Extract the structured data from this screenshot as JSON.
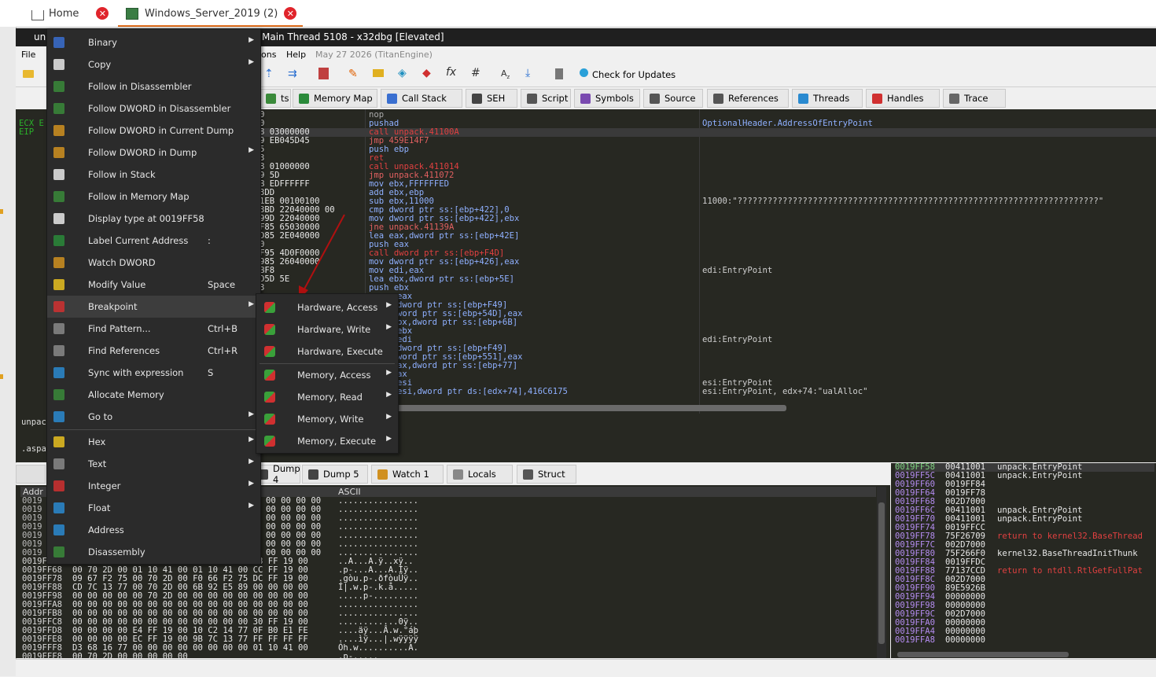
{
  "browser_tabs": [
    {
      "label": "Home",
      "close": "✕"
    },
    {
      "label": "Windows_Server_2019 (2)",
      "close": "✕"
    }
  ],
  "window": {
    "title_prefix": "un",
    "title": "Main Thread 5108 - x32dbg [Elevated]"
  },
  "menubar": {
    "file": "File",
    "options_partial": "ons",
    "help": "Help",
    "date": "May 27 2026 (TitanEngine)"
  },
  "toolbar": {
    "check_updates": "Check for Updates"
  },
  "view_tabs": [
    {
      "label": "ts",
      "icon": "log-icon"
    },
    {
      "label": "Memory Map",
      "icon": "memory-map-icon"
    },
    {
      "label": "Call Stack",
      "icon": "call-stack-icon"
    },
    {
      "label": "SEH",
      "icon": "seh-icon"
    },
    {
      "label": "Script",
      "icon": "script-icon"
    },
    {
      "label": "Symbols",
      "icon": "symbols-icon"
    },
    {
      "label": "Source",
      "icon": "source-icon"
    },
    {
      "label": "References",
      "icon": "references-icon"
    },
    {
      "label": "Threads",
      "icon": "threads-icon"
    },
    {
      "label": "Handles",
      "icon": "handles-icon"
    },
    {
      "label": "Trace",
      "icon": "trace-icon"
    }
  ],
  "registers_panel": {
    "line1": "ECX E",
    "line2": "EIP"
  },
  "disassembly": {
    "rows": [
      {
        "bytes": "0",
        "instr": "nop",
        "comment": ""
      },
      {
        "bytes": "0",
        "instr": "pushad",
        "comment": "OptionalHeader.AddressOfEntryPoint"
      },
      {
        "bytes": "8 03000000",
        "instr": "call unpack.41100A",
        "comment": ""
      },
      {
        "bytes": "9 EB045D45",
        "instr": "jmp 459E14F7",
        "comment": ""
      },
      {
        "bytes": "5",
        "instr": "push ebp",
        "comment": ""
      },
      {
        "bytes": "3",
        "instr": "ret",
        "comment": ""
      },
      {
        "bytes": "8 01000000",
        "instr": "call unpack.411014",
        "comment": ""
      },
      {
        "bytes": "9 5D",
        "instr": "jmp unpack.411072",
        "comment": ""
      },
      {
        "bytes": "B EDFFFFFF",
        "instr": "mov ebx,FFFFFFED",
        "comment": ""
      },
      {
        "bytes": "3DD",
        "instr": "add ebx,ebp",
        "comment": ""
      },
      {
        "bytes": "1EB 00100100",
        "instr": "sub ebx,11000",
        "comment": "11000:\"????????????????????????????????????????????????????????????????????????\""
      },
      {
        "bytes": "3BD 22040000 00",
        "instr": "cmp dword ptr ss:[ebp+422],0",
        "comment": ""
      },
      {
        "bytes": "99D 22040000",
        "instr": "mov dword ptr ss:[ebp+422],ebx",
        "comment": ""
      },
      {
        "bytes": "F85 65030000",
        "instr": "jne unpack.41139A",
        "comment": ""
      },
      {
        "bytes": "D85 2E040000",
        "instr": "lea eax,dword ptr ss:[ebp+42E]",
        "comment": ""
      },
      {
        "bytes": "0",
        "instr": "push eax",
        "comment": ""
      },
      {
        "bytes": "F95 4D0F0000",
        "instr": "call dword ptr ss:[ebp+F4D]",
        "comment": ""
      },
      {
        "bytes": "985 26040000",
        "instr": "mov dword ptr ss:[ebp+426],eax",
        "comment": ""
      },
      {
        "bytes": "BF8",
        "instr": "mov edi,eax",
        "comment": "edi:EntryPoint"
      },
      {
        "bytes": "D5D 5E",
        "instr": "lea ebx,dword ptr ss:[ebp+5E]",
        "comment": ""
      },
      {
        "bytes": "3",
        "instr": "push ebx",
        "comment": ""
      },
      {
        "bytes": "",
        "instr": "eax",
        "comment": ""
      },
      {
        "bytes": "",
        "instr": "dword ptr ss:[ebp+F49]",
        "comment": ""
      },
      {
        "bytes": "",
        "instr": "word ptr ss:[ebp+54D],eax",
        "comment": ""
      },
      {
        "bytes": "",
        "instr": "bx,dword ptr ss:[ebp+6B]",
        "comment": ""
      },
      {
        "bytes": "",
        "instr": "ebx",
        "comment": ""
      },
      {
        "bytes": "",
        "instr": "edi",
        "comment": "edi:EntryPoint"
      },
      {
        "bytes": "",
        "instr": "dword ptr ss:[ebp+F49]",
        "comment": ""
      },
      {
        "bytes": "",
        "instr": "word ptr ss:[ebp+551],eax",
        "comment": ""
      },
      {
        "bytes": "",
        "instr": "ax,dword ptr ss:[ebp+77]",
        "comment": ""
      },
      {
        "bytes": "",
        "instr": "ax",
        "comment": ""
      },
      {
        "bytes": "",
        "instr": "esi",
        "comment": "esi:EntryPoint"
      },
      {
        "bytes": "",
        "instr": "esi,dword ptr ds:[edx+74],416C6175",
        "comment": "esi:EntryPoint, edx+74:\"ualAlloc\""
      }
    ]
  },
  "middle_panel": {
    "line1": "unpac",
    "line2": ".aspa"
  },
  "dump_tabs": [
    {
      "label": "Dump 4",
      "icon": "dump-icon"
    },
    {
      "label": "Dump 5",
      "icon": "dump-icon"
    },
    {
      "label": "Watch 1",
      "icon": "watch-icon"
    },
    {
      "label": "Locals",
      "icon": "locals-icon"
    },
    {
      "label": "Struct",
      "icon": "struct-icon"
    }
  ],
  "dump": {
    "col_addr": "Addr",
    "col_ascii": "ASCII",
    "rows": [
      {
        "addr": "0019",
        "hex": "00 00 00 00",
        "ascii": "................"
      },
      {
        "addr": "0019",
        "hex": "00 00 00 00",
        "ascii": "................"
      },
      {
        "addr": "0019",
        "hex": "00 00 00 00",
        "ascii": "................"
      },
      {
        "addr": "0019",
        "hex": "00 00 00 00",
        "ascii": "................"
      },
      {
        "addr": "0019",
        "hex": "00 00 00 00",
        "ascii": "................"
      },
      {
        "addr": "0019",
        "hex": "00 00 00 00",
        "ascii": "................"
      },
      {
        "addr": "0019",
        "hex": "00 00 00 00",
        "ascii": "................"
      },
      {
        "addr": "0019FF58",
        "hex": "01 10 41 00 01 10 41 00 84 FF 19 00 78 FF 19 00",
        "ascii": "..A...A.ÿ..xÿ.."
      },
      {
        "addr": "0019FF68",
        "hex": "00 70 2D 00 01 10 41 00 01 10 41 00 CC FF 19 00",
        "ascii": ".p-...A...A.Ìÿ.."
      },
      {
        "addr": "0019FF78",
        "hex": "09 67 F2 75 00 70 2D 00 F0 66 F2 75 DC FF 19 00",
        "ascii": ".gòu.p-.ðfòuÜÿ.."
      },
      {
        "addr": "0019FF88",
        "hex": "CD 7C 13 77 00 70 2D 00 6B 92 E5 89 00 00 00 00",
        "ascii": "Í|.w.p-.k.å....."
      },
      {
        "addr": "0019FF98",
        "hex": "00 00 00 00 00 70 2D 00 00 00 00 00 00 00 00 00",
        "ascii": ".....p-........."
      },
      {
        "addr": "0019FFA8",
        "hex": "00 00 00 00 00 00 00 00 00 00 00 00 00 00 00 00",
        "ascii": "................"
      },
      {
        "addr": "0019FFB8",
        "hex": "00 00 00 00 00 00 00 00 00 00 00 00 00 00 00 00",
        "ascii": "................"
      },
      {
        "addr": "0019FFC8",
        "hex": "00 00 00 00 00 00 00 00 00 00 00 00 30 FF 19 00",
        "ascii": "............0ÿ.."
      },
      {
        "addr": "0019FFD8",
        "hex": "00 00 00 00 E4 FF 19 00 10 C2 14 77 0F B0 E1 FE",
        "ascii": "....äÿ...Â.w.°áþ"
      },
      {
        "addr": "0019FFE8",
        "hex": "00 00 00 00 EC FF 19 00 9B 7C 13 77 FF FF FF FF",
        "ascii": "....ìÿ...|.wÿÿÿÿ"
      },
      {
        "addr": "0019FFF8",
        "hex": "D3 68 16 77 00 00 00 00 00 00 00 00 01 10 41 00",
        "ascii": "Óh.w..........A."
      },
      {
        "addr": "0019FFF8",
        "hex": "00 70 2D 00 00 00 00 00",
        "ascii": ".p-....."
      }
    ]
  },
  "stack": {
    "rows": [
      {
        "addr": "0019FF58",
        "val": "00411001",
        "comment": "unpack.EntryPoint"
      },
      {
        "addr": "0019FF5C",
        "val": "00411001",
        "comment": "unpack.EntryPoint"
      },
      {
        "addr": "0019FF60",
        "val": "0019FF84",
        "comment": ""
      },
      {
        "addr": "0019FF64",
        "val": "0019FF78",
        "comment": ""
      },
      {
        "addr": "0019FF68",
        "val": "002D7000",
        "comment": ""
      },
      {
        "addr": "0019FF6C",
        "val": "00411001",
        "comment": "unpack.EntryPoint"
      },
      {
        "addr": "0019FF70",
        "val": "00411001",
        "comment": "unpack.EntryPoint"
      },
      {
        "addr": "0019FF74",
        "val": "0019FFCC",
        "comment": ""
      },
      {
        "addr": "0019FF78",
        "val": "75F26709",
        "comment": "return to kernel32.BaseThread"
      },
      {
        "addr": "0019FF7C",
        "val": "002D7000",
        "comment": ""
      },
      {
        "addr": "0019FF80",
        "val": "75F266F0",
        "comment": "kernel32.BaseThreadInitThunk"
      },
      {
        "addr": "0019FF84",
        "val": "0019FFDC",
        "comment": ""
      },
      {
        "addr": "0019FF88",
        "val": "77137CCD",
        "comment": "return to ntdll.RtlGetFullPat"
      },
      {
        "addr": "0019FF8C",
        "val": "002D7000",
        "comment": ""
      },
      {
        "addr": "0019FF90",
        "val": "89E5926B",
        "comment": ""
      },
      {
        "addr": "0019FF94",
        "val": "00000000",
        "comment": ""
      },
      {
        "addr": "0019FF98",
        "val": "00000000",
        "comment": ""
      },
      {
        "addr": "0019FF9C",
        "val": "002D7000",
        "comment": ""
      },
      {
        "addr": "0019FFA0",
        "val": "00000000",
        "comment": ""
      },
      {
        "addr": "0019FFA4",
        "val": "00000000",
        "comment": ""
      },
      {
        "addr": "0019FFA8",
        "val": "00000000",
        "comment": ""
      }
    ]
  },
  "context_menu": {
    "items": [
      {
        "label": "Binary",
        "shortcut": "",
        "arrow": "▶",
        "icon": "binary-icon"
      },
      {
        "label": "Copy",
        "shortcut": "",
        "arrow": "▶",
        "icon": "copy-icon"
      },
      {
        "label": "Follow in Disassembler",
        "shortcut": "",
        "arrow": "",
        "icon": "disassembler-icon"
      },
      {
        "label": "Follow DWORD in Disassembler",
        "shortcut": "",
        "arrow": "",
        "icon": "disassembler-icon"
      },
      {
        "label": "Follow DWORD in Current Dump",
        "shortcut": "",
        "arrow": "",
        "icon": "dump-icon"
      },
      {
        "label": "Follow DWORD in Dump",
        "shortcut": "",
        "arrow": "▶",
        "icon": "dump-icon"
      },
      {
        "label": "Follow in Stack",
        "shortcut": "",
        "arrow": "",
        "icon": "stack-icon"
      },
      {
        "label": "Follow in Memory Map",
        "shortcut": "",
        "arrow": "",
        "icon": "memory-map-icon"
      },
      {
        "label": "Display type at 0019FF58",
        "shortcut": "",
        "arrow": "",
        "icon": "display-type-icon"
      },
      {
        "label": "Label Current Address",
        "shortcut": ":",
        "arrow": "",
        "icon": "label-icon"
      },
      {
        "label": "Watch DWORD",
        "shortcut": "",
        "arrow": "",
        "icon": "watch-icon"
      },
      {
        "label": "Modify Value",
        "shortcut": "Space",
        "arrow": "",
        "icon": "modify-icon"
      },
      {
        "label": "Breakpoint",
        "shortcut": "",
        "arrow": "▶",
        "icon": "breakpoint-icon"
      },
      {
        "label": "Find Pattern...",
        "shortcut": "Ctrl+B",
        "arrow": "",
        "icon": "find-pattern-icon"
      },
      {
        "label": "Find References",
        "shortcut": "Ctrl+R",
        "arrow": "",
        "icon": "find-references-icon"
      },
      {
        "label": "Sync with expression",
        "shortcut": "S",
        "arrow": "",
        "icon": "sync-icon"
      },
      {
        "label": "Allocate Memory",
        "shortcut": "",
        "arrow": "",
        "icon": "allocate-icon"
      },
      {
        "label": "Go to",
        "shortcut": "",
        "arrow": "▶",
        "icon": "goto-icon"
      },
      {
        "label": "Hex",
        "shortcut": "",
        "arrow": "▶",
        "icon": "hex-icon"
      },
      {
        "label": "Text",
        "shortcut": "",
        "arrow": "▶",
        "icon": "text-icon"
      },
      {
        "label": "Integer",
        "shortcut": "",
        "arrow": "▶",
        "icon": "integer-icon"
      },
      {
        "label": "Float",
        "shortcut": "",
        "arrow": "▶",
        "icon": "float-icon"
      },
      {
        "label": "Address",
        "shortcut": "",
        "arrow": "",
        "icon": "address-icon"
      },
      {
        "label": "Disassembly",
        "shortcut": "",
        "arrow": "",
        "icon": "disassembly-icon"
      }
    ]
  },
  "breakpoint_submenu": {
    "items": [
      {
        "label": "Hardware, Access",
        "arrow": "▶",
        "icon": "hw-access-icon"
      },
      {
        "label": "Hardware, Write",
        "arrow": "▶",
        "icon": "hw-write-icon"
      },
      {
        "label": "Hardware, Execute",
        "arrow": "",
        "icon": "hw-execute-icon"
      },
      {
        "label": "Memory, Access",
        "arrow": "▶",
        "icon": "mem-access-icon"
      },
      {
        "label": "Memory, Read",
        "arrow": "▶",
        "icon": "mem-read-icon"
      },
      {
        "label": "Memory, Write",
        "arrow": "▶",
        "icon": "mem-write-icon"
      },
      {
        "label": "Memory, Execute",
        "arrow": "▶",
        "icon": "mem-execute-icon"
      }
    ]
  },
  "colors": {
    "disasm_bg": "#272822",
    "call_red": "#e04040",
    "jump_orange": "#e06060",
    "instr_blue": "#8fb0ff",
    "addr_purple": "#b48cf0",
    "annotation_arrow": "#b01010"
  }
}
